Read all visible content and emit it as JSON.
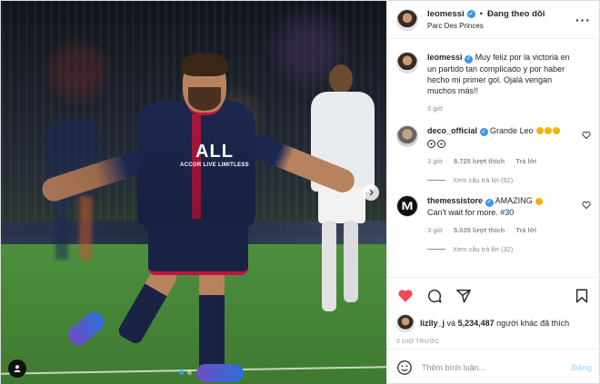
{
  "post": {
    "author": "leomessi",
    "follow_label": "Đang theo dõi",
    "separator": "•",
    "location": "Parc Des Princes",
    "photo_sponsor": "ALL",
    "photo_sponsor_sub": "ACCOR LIVE LIMITLESS"
  },
  "caption": {
    "author": "leomessi",
    "text": "Muy feliz por la victoria en un partido tan complicado y por haber hecho mi primer gol. Ojalá vengan muchos más!!",
    "time": "3 giờ"
  },
  "comments": [
    {
      "author": "deco_official",
      "text": "Grande Leo",
      "time": "3 giờ",
      "likes": "8.725 lượt thích",
      "reply_label": "Trả lời",
      "view_replies": "Xem câu trả lời (52)"
    },
    {
      "author": "themessistore",
      "text": "AMAZING",
      "text2": "Can't wait for more.",
      "hashtag": "#30",
      "time": "3 giờ",
      "likes": "5.035 lượt thích",
      "reply_label": "Trả lời",
      "view_replies": "Xem câu trả lời (32)"
    }
  ],
  "likes": {
    "user": "lizlly_j",
    "joiner": "và",
    "count": "5,234,487",
    "suffix": "người khác đã thích"
  },
  "posted_ago": "3 GIỜ TRƯỚC",
  "add_comment": {
    "placeholder": "Thêm bình luận...",
    "post_label": "Đăng"
  },
  "colors": {
    "accent": "#3897f0",
    "like_red": "#ed4956",
    "post_disabled": "#b2dffc"
  }
}
